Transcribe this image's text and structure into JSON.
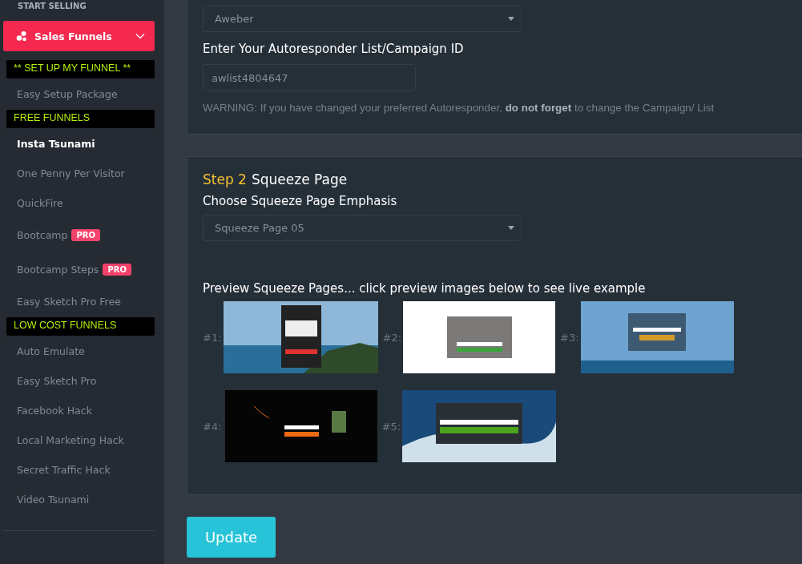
{
  "sidebar": {
    "section_title": "START SELLING",
    "menu_button": {
      "label": "Sales Funnels",
      "expanded": true
    },
    "items": [
      {
        "kind": "label",
        "label": "** SET UP MY FUNNEL **"
      },
      {
        "kind": "link",
        "label": "Easy Setup Package",
        "selected": false
      },
      {
        "kind": "label",
        "label": "FREE FUNNELS"
      },
      {
        "kind": "link",
        "label": "Insta Tsunami",
        "selected": true
      },
      {
        "kind": "link",
        "label": "One Penny Per Visitor",
        "selected": false
      },
      {
        "kind": "link",
        "label": "QuickFire",
        "selected": false
      },
      {
        "kind": "link",
        "label": "Bootcamp",
        "badge": "PRO",
        "selected": false
      },
      {
        "kind": "link",
        "label": "Bootcamp Steps",
        "badge": "PRO",
        "selected": false
      },
      {
        "kind": "link",
        "label": "Easy Sketch Pro Free",
        "selected": false
      },
      {
        "kind": "label",
        "label": "LOW COST FUNNELS"
      },
      {
        "kind": "link",
        "label": "Auto Emulate",
        "selected": false
      },
      {
        "kind": "link",
        "label": "Easy Sketch Pro",
        "selected": false
      },
      {
        "kind": "link",
        "label": "Facebook Hack",
        "selected": false
      },
      {
        "kind": "link",
        "label": "Local Marketing Hack",
        "selected": false
      },
      {
        "kind": "link",
        "label": "Secret Traffic Hack",
        "selected": false
      },
      {
        "kind": "link",
        "label": "Video Tsunami",
        "selected": false
      }
    ]
  },
  "autoresponder_panel": {
    "provider_select": {
      "value": "Aweber"
    },
    "list_id_label": "Enter Your Autoresponder List/Campaign ID",
    "list_id_field": {
      "value": "awlist4804647"
    },
    "warning": "WARNING: If you have changed your preferred Autoresponder, **do not forget** to change the Campaign/ List"
  },
  "squeeze_panel": {
    "step": "Step 2",
    "title": "Squeeze Page",
    "emphasis_label": "Choose Squeeze Page Emphasis",
    "emphasis_select": {
      "value": "Squeeze Page 05"
    },
    "preview_title": "Preview Squeeze Pages... click preview images below to see live example",
    "previews": [
      {
        "label": "#1:",
        "kind": "coast"
      },
      {
        "label": "#2:",
        "kind": "white"
      },
      {
        "label": "#3:",
        "kind": "sky"
      },
      {
        "label": "#4:",
        "kind": "dark"
      },
      {
        "label": "#5:",
        "kind": "wave"
      }
    ]
  },
  "update_button": "Update"
}
